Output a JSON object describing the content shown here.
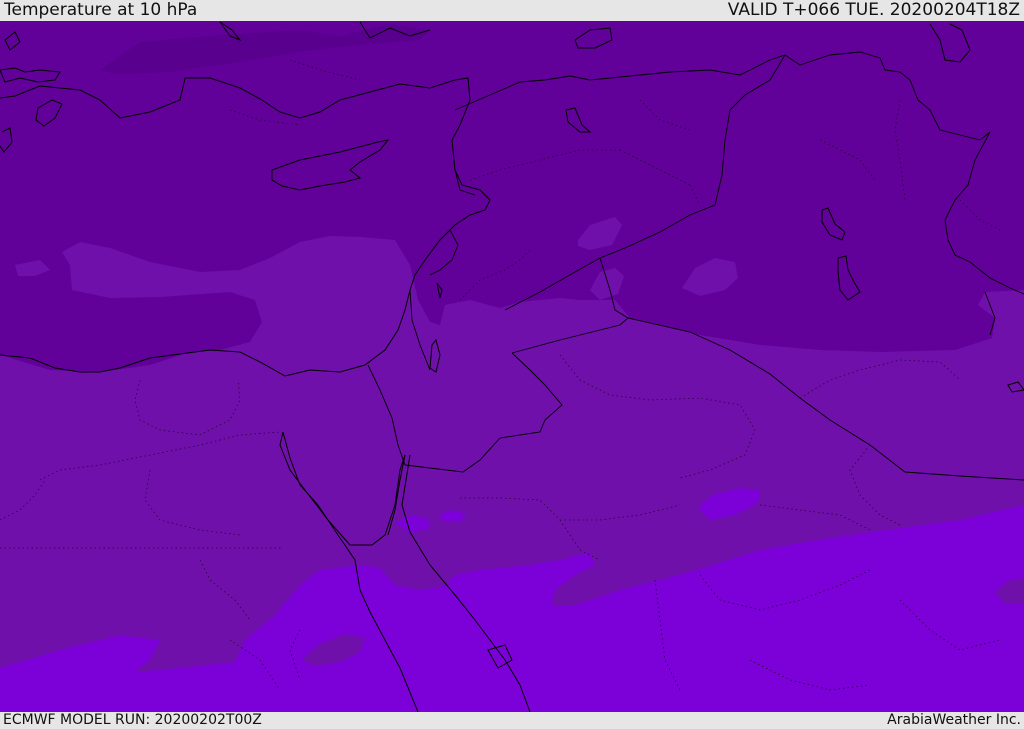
{
  "header": {
    "title": "Temperature at 10 hPa",
    "valid": "VALID T+066 TUE. 20200204T18Z"
  },
  "footer": {
    "model_run": "ECMWF MODEL RUN: 20200202T00Z",
    "credit": "ArabiaWeather Inc."
  },
  "colors": {
    "band_cold": "#62009a",
    "band_mid": "#7010aa",
    "band_warm": "#7c00d8",
    "coast_line": "#000000"
  }
}
